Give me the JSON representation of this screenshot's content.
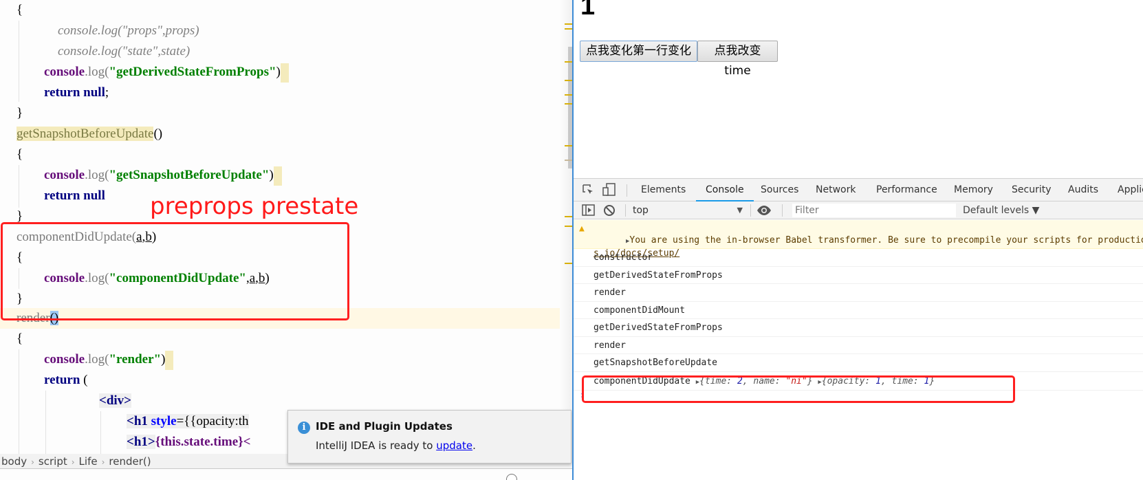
{
  "editor": {
    "code_lines": {
      "l0": "{",
      "l1": "console.log(\"props\",props)",
      "l2": "console.log(\"state\",state)",
      "l3_obj": "console",
      "l3_fn": ".log(",
      "l3_str": "\"getDerivedStateFromProps\"",
      "l3_end": ")",
      "l4_kw": "return null",
      "l4_end": ";",
      "l5": "}",
      "l6_method": "getSnapshotBeforeUpdate",
      "l6_end": "()",
      "l7": "{",
      "l8_obj": "console",
      "l8_fn": ".log(",
      "l8_str": "\"getSnapshotBeforeUpdate\"",
      "l8_end": ")",
      "l9_kw": "return null",
      "l10": "}",
      "l11_method": "componentDidUpdate(",
      "l11_a": "a",
      "l11_comma": ",",
      "l11_b": "b",
      "l11_end": ")",
      "l12": "{",
      "l13_obj": "console",
      "l13_fn": ".log(",
      "l13_str": "\"componentDidUpdate\"",
      "l13_comma": ",",
      "l13_a": "a",
      "l13_comma2": ",",
      "l13_b": "b",
      "l13_end": ")",
      "l14": "}",
      "l15_method": "render",
      "l15_paren": "()",
      "l16": "{",
      "l17_obj": "console",
      "l17_fn": ".log(",
      "l17_str": "\"render\"",
      "l17_end": ")",
      "l18_kw": "return",
      "l18_end": " (",
      "l19_tag": "<div>",
      "l20_tag": "<h1",
      "l20_attr": " style",
      "l20_rest": "={{opacity:th",
      "l21_tag": "<h1>",
      "l21_expr": "{this.state.time}<"
    },
    "annotation": "preprops prestate",
    "breadcrumb": [
      "body",
      "script",
      "Life",
      "render()"
    ],
    "notification": {
      "title": "IDE and Plugin Updates",
      "body_prefix": "IntelliJ IDEA is ready to ",
      "link": "update",
      "body_suffix": "."
    }
  },
  "page": {
    "heading": "1",
    "buttons": [
      "点我变化第一行变化",
      "点我改变time"
    ]
  },
  "devtools": {
    "tabs": [
      "Elements",
      "Console",
      "Sources",
      "Network",
      "Performance",
      "Memory",
      "Security",
      "Audits",
      "Applic"
    ],
    "active_tab": "Console",
    "context": "top",
    "filter_placeholder": "Filter",
    "levels": "Default levels ▼",
    "warning": {
      "line1": "You are using the in-browser Babel transformer. Be sure to precompile your scripts for productio",
      "line2": "s.io/docs/setup/"
    },
    "messages": [
      "constructor",
      "getDerivedStateFromProps",
      "render",
      "componentDidMount",
      "getDerivedStateFromProps",
      "render",
      "getSnapshotBeforeUpdate"
    ],
    "last_message": {
      "label": "componentDidUpdate",
      "obj1": {
        "k1": "time",
        "v1": "2",
        "k2": "name",
        "v2": "\"ni\""
      },
      "obj2": {
        "k1": "opacity",
        "v1": "1",
        "k2": "time",
        "v2": "1"
      }
    },
    "prompt": "›"
  }
}
